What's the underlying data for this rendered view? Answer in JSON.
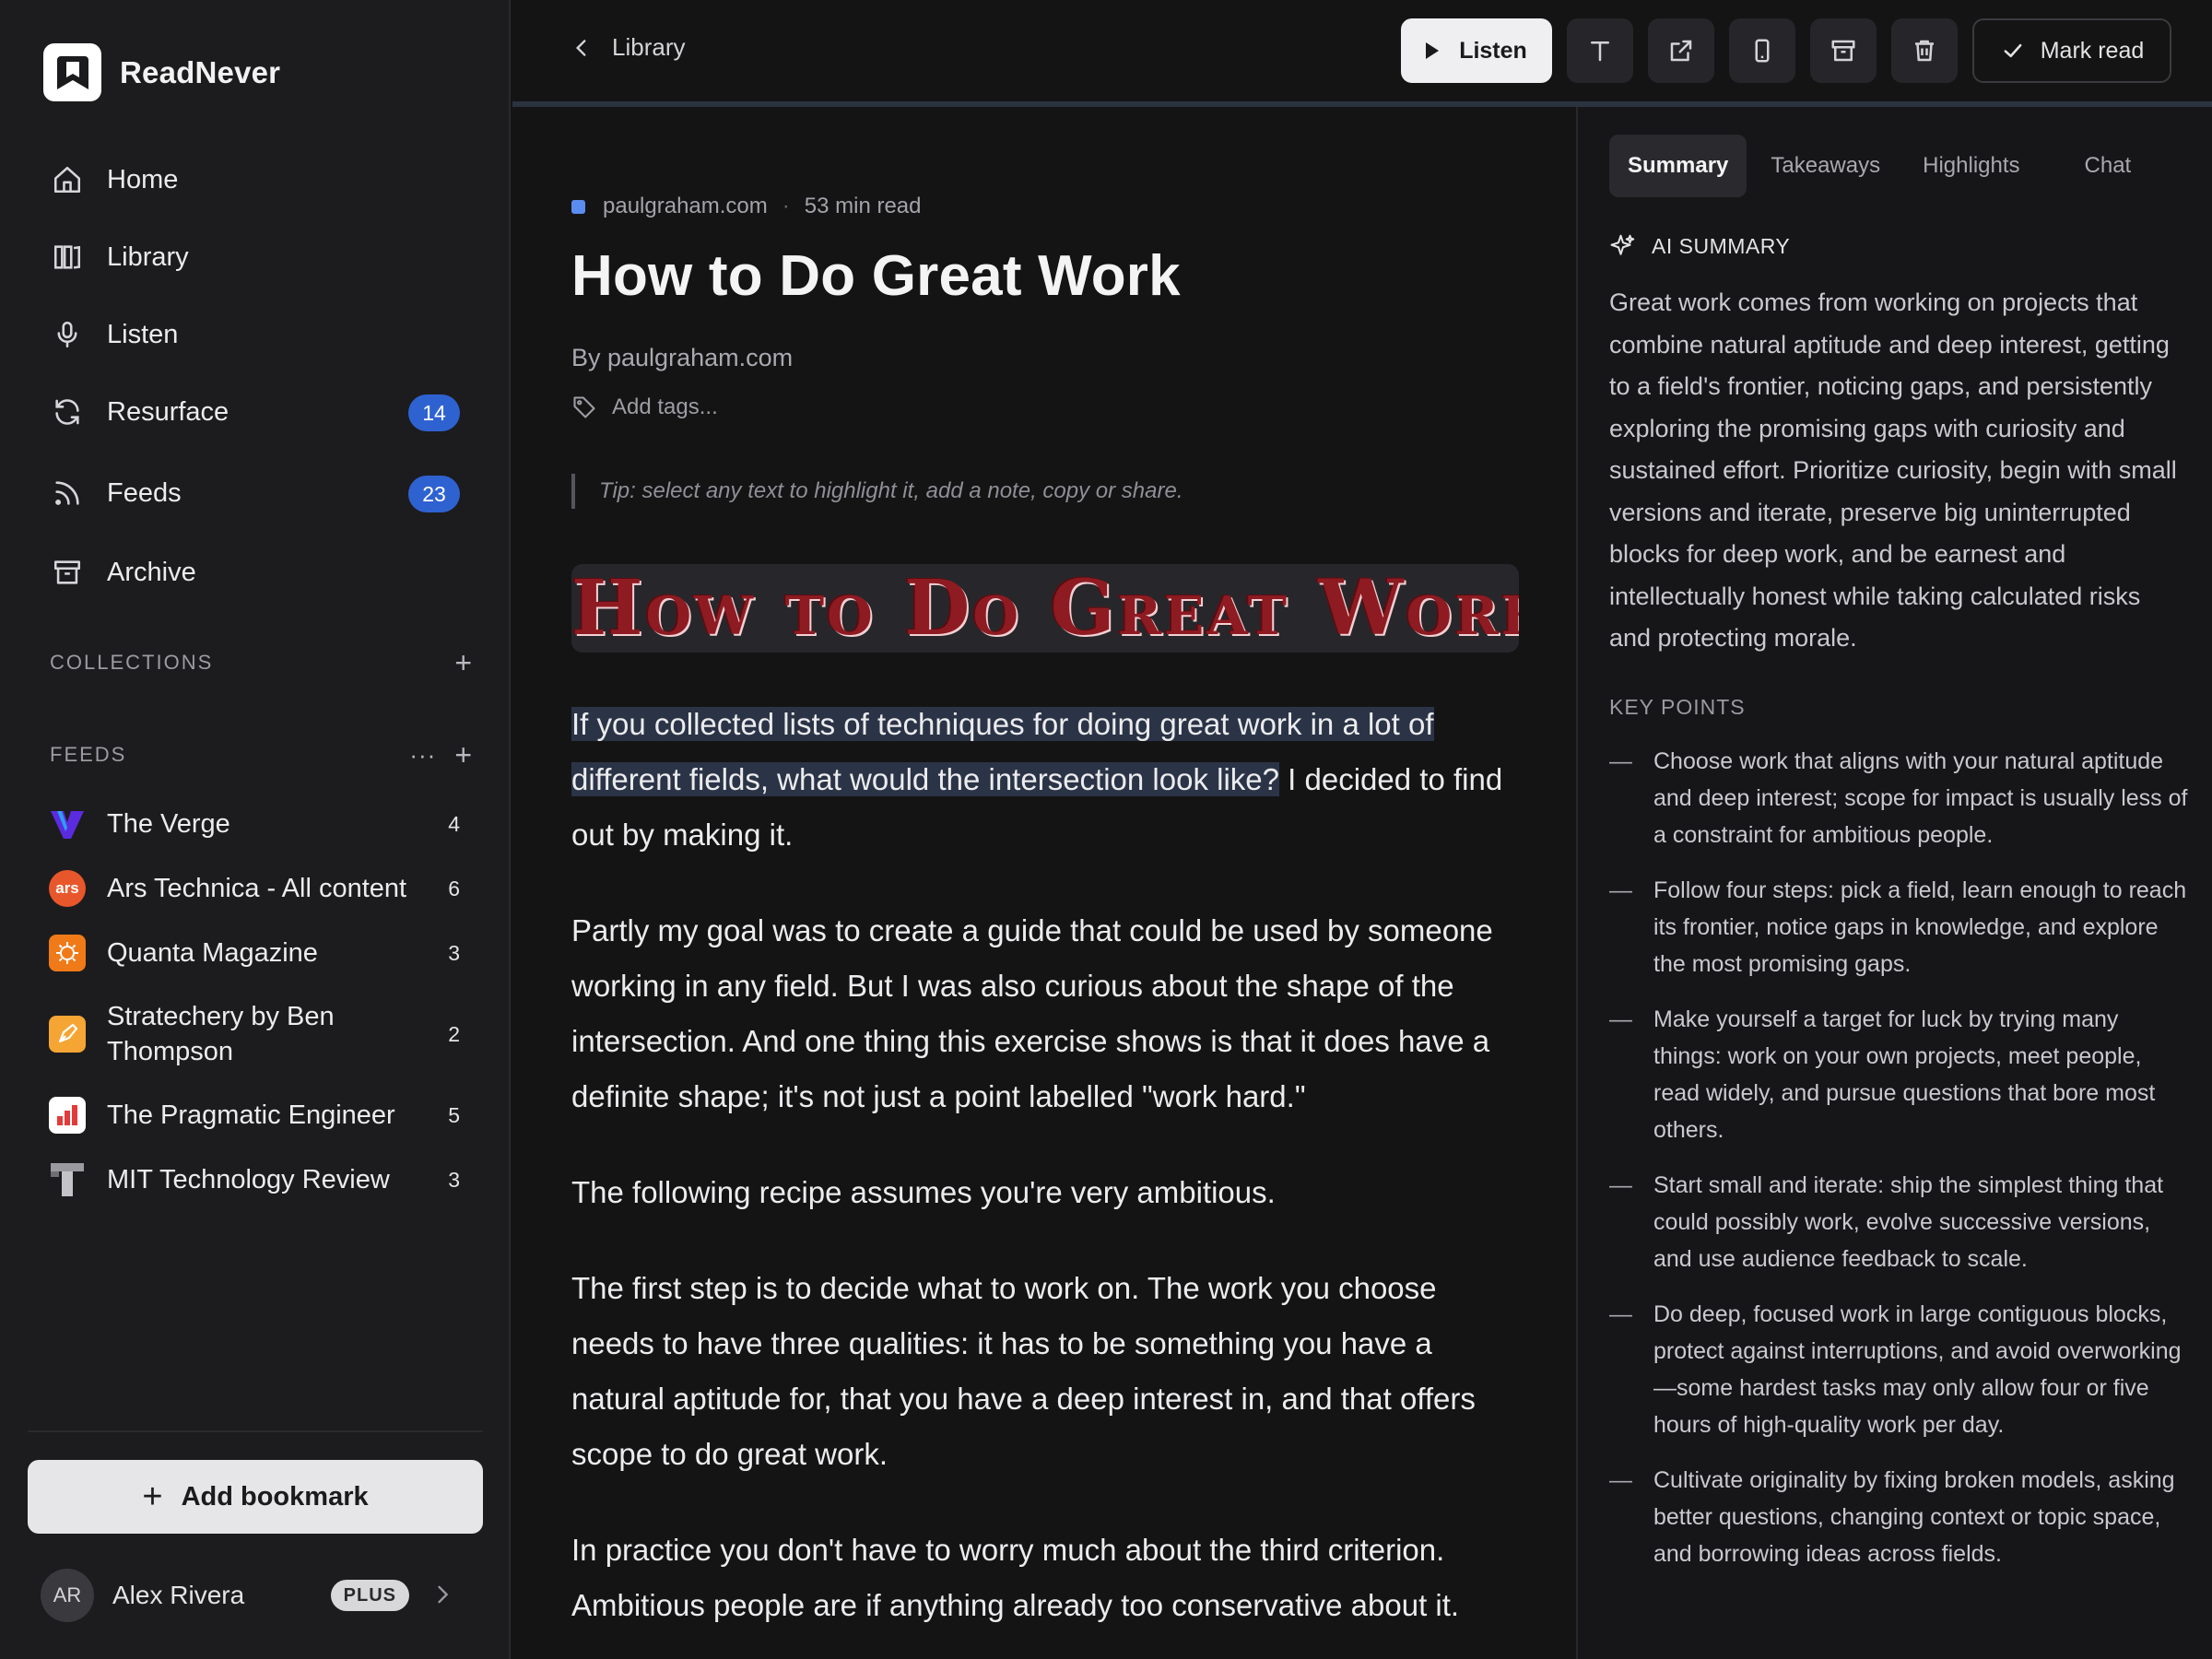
{
  "app": {
    "name": "ReadNever"
  },
  "nav": [
    {
      "label": "Home",
      "icon": "home-icon"
    },
    {
      "label": "Library",
      "icon": "library-icon"
    },
    {
      "label": "Listen",
      "icon": "microphone-icon"
    },
    {
      "label": "Resurface",
      "icon": "refresh-icon",
      "badge": "14"
    },
    {
      "label": "Feeds",
      "icon": "rss-icon",
      "badge": "23"
    },
    {
      "label": "Archive",
      "icon": "archive-icon"
    }
  ],
  "collections": {
    "title": "COLLECTIONS"
  },
  "feeds_section": {
    "title": "FEEDS",
    "items": [
      {
        "label": "The Verge",
        "count": "4",
        "icon": "verge-icon",
        "color": "#5b2be0"
      },
      {
        "label": "Ars Technica - All content",
        "count": "6",
        "icon": "ars-icon",
        "icon_text": "ars",
        "color": "#e8572b"
      },
      {
        "label": "Quanta Magazine",
        "count": "3",
        "icon": "quanta-icon",
        "color": "#f07a18"
      },
      {
        "label": "Stratechery by Ben Thompson",
        "count": "2",
        "icon": "stratechery-icon",
        "color": "#f4a534"
      },
      {
        "label": "The Pragmatic Engineer",
        "count": "5",
        "icon": "pragmatic-engineer-icon",
        "color": "#e23b3b"
      },
      {
        "label": "MIT Technology Review",
        "count": "3",
        "icon": "mit-review-icon",
        "color": "#9a9aa0"
      }
    ]
  },
  "sidebar_footer": {
    "add_bookmark": "Add bookmark",
    "user": {
      "initials": "AR",
      "name": "Alex Rivera",
      "plan": "PLUS"
    }
  },
  "toolbar": {
    "back_label": "Library",
    "listen_label": "Listen",
    "mark_read_label": "Mark read",
    "icons": [
      "text-size-icon",
      "external-link-icon",
      "mobile-icon",
      "archive-icon",
      "trash-icon"
    ]
  },
  "article": {
    "source": "paulgraham.com",
    "read_time": "53 min read",
    "title": "How to Do Great Work",
    "byline": "By paulgraham.com",
    "tags_placeholder": "Add tags...",
    "tip": "Tip: select any text to highlight it, add a note, copy or share.",
    "hero_text": "How to Do Great Work",
    "p1_highlight": "If you collected lists of techniques for doing great work in a lot of different fields, what would the intersection look like?",
    "p1_rest": " I decided to find out by making it.",
    "p2": "Partly my goal was to create a guide that could be used by someone working in any field. But I was also curious about the shape of the intersection. And one thing this exercise shows is that it does have a definite shape; it's not just a point labelled \"work hard.\"",
    "p3": "The following recipe assumes you're very ambitious.",
    "p4": "The first step is to decide what to work on. The work you choose needs to have three qualities: it has to be something you have a natural aptitude for, that you have a deep interest in, and that offers scope to do great work.",
    "p5": "In practice you don't have to worry much about the third criterion. Ambitious people are if anything already too conservative about it."
  },
  "panel": {
    "tabs": [
      "Summary",
      "Takeaways",
      "Highlights",
      "Chat"
    ],
    "active_tab": "Summary",
    "ai_heading": "AI SUMMARY",
    "summary": "Great work comes from working on projects that combine natural aptitude and deep interest, getting to a field's frontier, noticing gaps, and persistently exploring the promising gaps with curiosity and sustained effort. Prioritize curiosity, begin with small versions and iterate, preserve big uninterrupted blocks for deep work, and be earnest and intellectually honest while taking calculated risks and protecting morale.",
    "key_points_heading": "KEY POINTS",
    "key_points": [
      "Choose work that aligns with your natural aptitude and deep interest; scope for impact is usually less of a constraint for ambitious people.",
      "Follow four steps: pick a field, learn enough to reach its frontier, notice gaps in knowledge, and explore the most promising gaps.",
      "Make yourself a target for luck by trying many things: work on your own projects, meet people, read widely, and pursue questions that bore most others.",
      "Start small and iterate: ship the simplest thing that could possibly work, evolve successive versions, and use audience feedback to scale.",
      "Do deep, focused work in large contiguous blocks, protect against interruptions, and avoid overworking—some hardest tasks may only allow four or five hours of high-quality work per day.",
      "Cultivate originality by fixing broken models, asking better questions, changing context or topic space, and borrowing ideas across fields."
    ]
  }
}
